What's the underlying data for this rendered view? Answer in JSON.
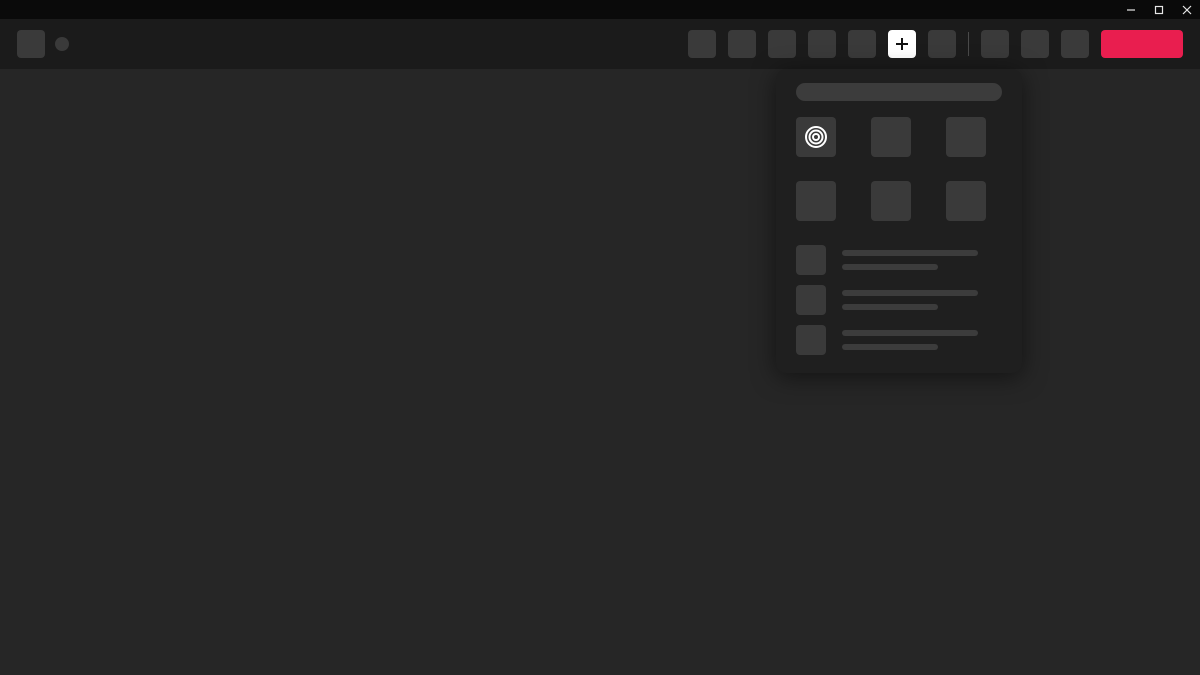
{
  "window": {
    "minimize": "Minimize",
    "maximize": "Maximize",
    "close": "Close"
  },
  "topbar": {
    "logo": "app-logo",
    "nav_items": [
      {
        "name": "nav-1"
      },
      {
        "name": "nav-2"
      },
      {
        "name": "nav-3"
      },
      {
        "name": "nav-4"
      },
      {
        "name": "nav-5"
      },
      {
        "name": "nav-add",
        "active": true
      },
      {
        "name": "nav-7"
      }
    ],
    "secondary_items": [
      {
        "name": "sec-1"
      },
      {
        "name": "sec-2"
      },
      {
        "name": "sec-3"
      }
    ],
    "cta_label": ""
  },
  "dropdown": {
    "search_placeholder": "",
    "tiles": [
      {
        "name": "tile-1",
        "selected": true,
        "icon": "spiral-icon"
      },
      {
        "name": "tile-2"
      },
      {
        "name": "tile-3"
      },
      {
        "name": "tile-4"
      },
      {
        "name": "tile-5"
      },
      {
        "name": "tile-6"
      }
    ],
    "list": [
      {
        "title": "",
        "subtitle": ""
      },
      {
        "title": "",
        "subtitle": ""
      },
      {
        "title": "",
        "subtitle": ""
      }
    ]
  },
  "colors": {
    "accent": "#e91e4f",
    "highlight": "#4b4bff",
    "bg": "#262626",
    "panel": "#1f1f1f",
    "chip": "#3a3a3a"
  }
}
